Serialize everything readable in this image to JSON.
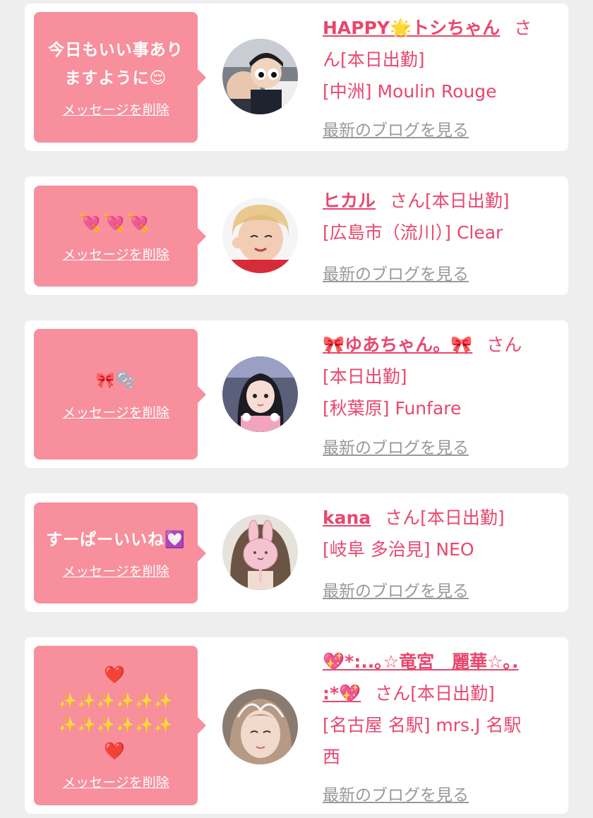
{
  "colors": {
    "page_bg": "#eeeeee",
    "card_bg": "#ffffff",
    "bubble_bg": "#f78f9c",
    "accent": "#e8476e",
    "muted": "#999999"
  },
  "delete_label": "メッセージを削除",
  "blog_label": "最新のブログを見る",
  "entries": [
    {
      "message": "今日もいい事あり\nますように😌",
      "name": "HAPPY🌟トシちゃん",
      "suffix_a": "さ",
      "suffix_b": "ん[本日出勤]",
      "shop": "[中洲] Moulin Rouge",
      "avatar": "group-photo"
    },
    {
      "message": "💘💘💘",
      "name": "ヒカル",
      "suffix_a": "さん[本日出勤]",
      "shop": "[広島市（流川）] Clear",
      "avatar": "blonde-girl"
    },
    {
      "message": "🎀🫧",
      "name": "🎀ゆあちゃん。🎀",
      "suffix_a": "さん",
      "suffix_b": "[本日出勤]",
      "shop": "[秋葉原] Funfare",
      "avatar": "idol-girl"
    },
    {
      "message": "すーぱーいいね💟",
      "name": "kana",
      "suffix_a": "さん[本日出勤]",
      "shop": "[岐阜 多治見] NEO",
      "avatar": "bunny-face"
    },
    {
      "message_top": "❤️",
      "message_mid": "✨✨✨✨✨✨\n✨✨✨✨✨✨",
      "message_bottom": "❤️",
      "name_a": "💖*:..｡☆竜宮　麗華☆｡.",
      "name_b": ":*💖",
      "suffix_a": "さん[本日出勤]",
      "shop_a": "[名古屋 名駅] mrs.J 名駅",
      "shop_b": "西",
      "avatar": "tiara-girl"
    }
  ]
}
